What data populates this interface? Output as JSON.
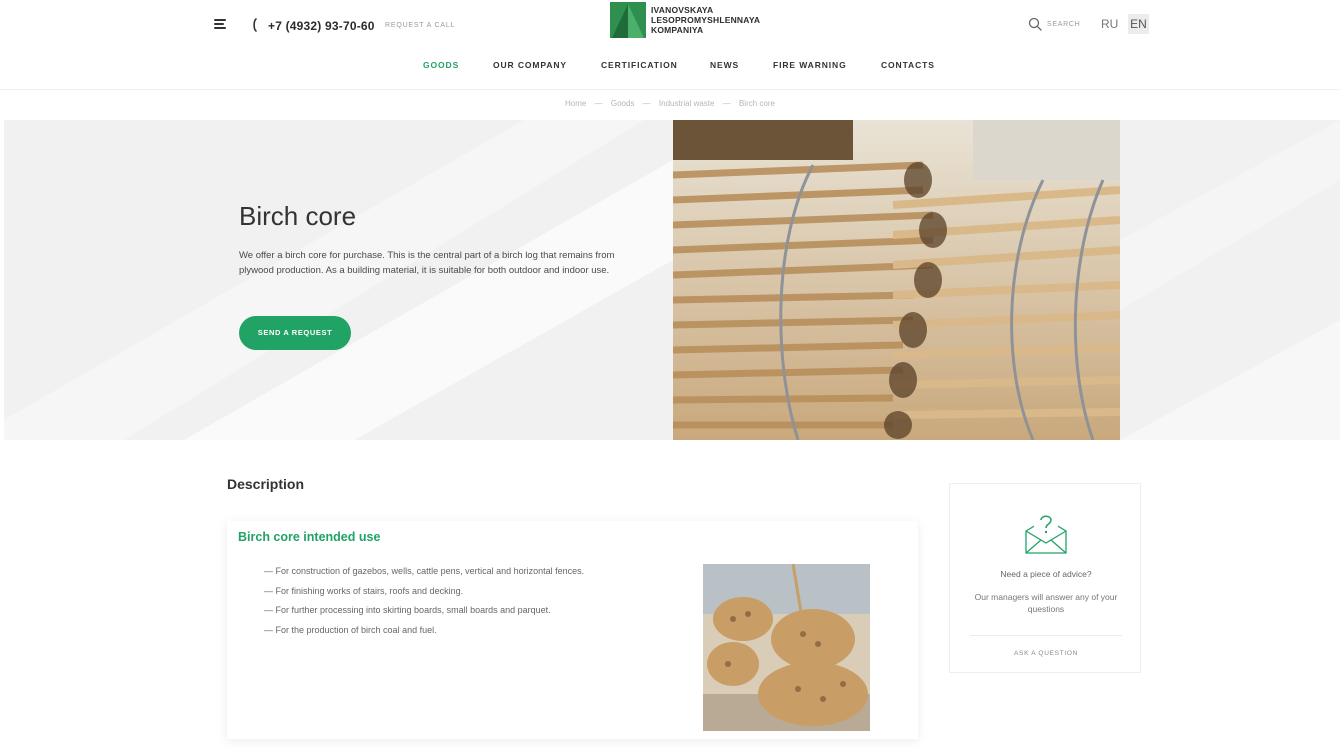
{
  "header": {
    "phone": "+7 (4932) 93-70-60",
    "request_call": "REQUEST A CALL",
    "logo_lines": [
      "IVANOVSKAYA",
      "LESOPROMYSHLENNAYA",
      "KOMPANIYA"
    ],
    "search_label": "SEARCH",
    "lang_ru": "RU",
    "lang_en": "EN",
    "icons": [
      "menu-icon",
      "phone-icon",
      "search-icon"
    ]
  },
  "nav": {
    "items": [
      {
        "label": "GOODS",
        "active": true
      },
      {
        "label": "OUR COMPANY",
        "active": false
      },
      {
        "label": "CERTIFICATION",
        "active": false
      },
      {
        "label": "NEWS",
        "active": false
      },
      {
        "label": "FIRE WARNING",
        "active": false
      },
      {
        "label": "CONTACTS",
        "active": false
      }
    ]
  },
  "breadcrumb": {
    "items": [
      "Home",
      "Goods",
      "Industrial waste",
      "Birch core"
    ],
    "separator": "—"
  },
  "hero": {
    "title": "Birch core",
    "text": "We offer a birch core for purchase. This is the central part of a birch log that remains from plywood production. As a building material, it is suitable for both outdoor and indoor use.",
    "button": "SEND A REQUEST"
  },
  "description": {
    "title": "Description",
    "card_title": "Birch core intended use",
    "items": [
      "— For construction of gazebos, wells, cattle pens, vertical and horizontal fences.",
      "— For finishing works of stairs, roofs and decking.",
      "— For further processing into skirting boards, small boards and parquet.",
      "— For the production of birch coal and fuel."
    ]
  },
  "advice": {
    "title": "Need a piece of advice?",
    "text": "Our managers will answer any of your questions",
    "link": "ASK A QUESTION",
    "icon": "envelope-question-icon"
  },
  "colors": {
    "accent": "#21a366",
    "logo_dark": "#1f6b3a",
    "logo_light": "#3aa55c"
  }
}
